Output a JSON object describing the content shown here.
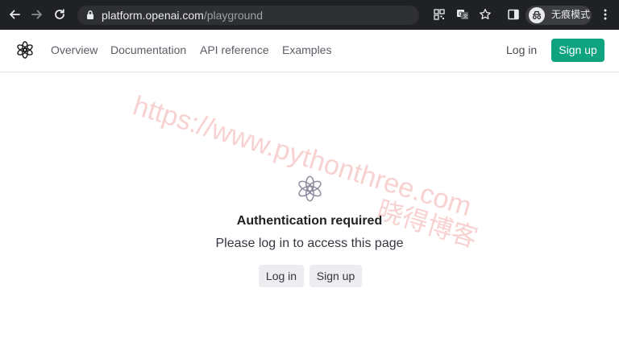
{
  "browser": {
    "url_host": "platform.openai.com",
    "url_path": "/playground",
    "incognito_label": "无痕模式"
  },
  "nav": {
    "links": [
      "Overview",
      "Documentation",
      "API reference",
      "Examples"
    ],
    "login": "Log in",
    "signup": "Sign up"
  },
  "auth": {
    "title": "Authentication required",
    "subtitle": "Please log in to access this page",
    "login_button": "Log in",
    "signup_button": "Sign up"
  },
  "watermark": {
    "url": "https://www.pythonthree.com",
    "cn": "晓得博客"
  },
  "colors": {
    "brand_green": "#10a37f",
    "chrome_bg": "#202124",
    "watermark": "#f6c6c6"
  }
}
